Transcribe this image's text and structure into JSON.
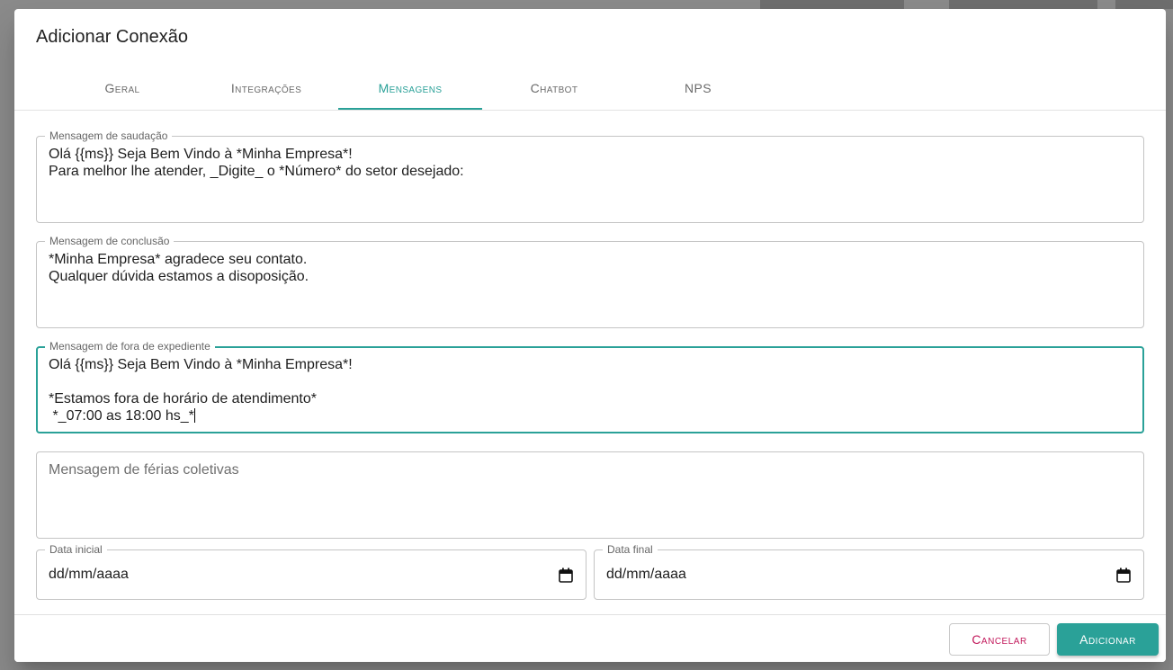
{
  "dialog": {
    "title": "Adicionar Conexão"
  },
  "tabs": [
    {
      "label": "Geral",
      "active": false
    },
    {
      "label": "Integrações",
      "active": false
    },
    {
      "label": "Mensagens",
      "active": true
    },
    {
      "label": "Chatbot",
      "active": false
    },
    {
      "label": "NPS",
      "active": false
    }
  ],
  "fields": {
    "greeting": {
      "label": "Mensagem de saudação",
      "value": "Olá {{ms}} Seja Bem Vindo à *Minha Empresa*!\nPara melhor lhe atender, _Digite_ o *Número* do setor desejado:"
    },
    "conclusion": {
      "label": "Mensagem de conclusão",
      "value": "*Minha Empresa* agradece seu contato.\nQualquer dúvida estamos a disoposição."
    },
    "out_of_hours": {
      "label": "Mensagem de fora de expediente",
      "value": "Olá {{ms}} Seja Bem Vindo à *Minha Empresa*!\n\n*Estamos fora de horário de atendimento*\n *_07:00 as 18:00 hs_*"
    },
    "vacation": {
      "placeholder": "Mensagem de férias coletivas",
      "value": ""
    },
    "start_date": {
      "label": "Data inicial",
      "value": "dd/mm/aaaa"
    },
    "end_date": {
      "label": "Data final",
      "value": "dd/mm/aaaa"
    }
  },
  "footer": {
    "cancel_label": "Cancelar",
    "add_label": "Adicionar"
  },
  "colors": {
    "accent": "#2aa198",
    "cancel": "#c2185b"
  },
  "icons": {
    "date": "calendar-icon"
  }
}
